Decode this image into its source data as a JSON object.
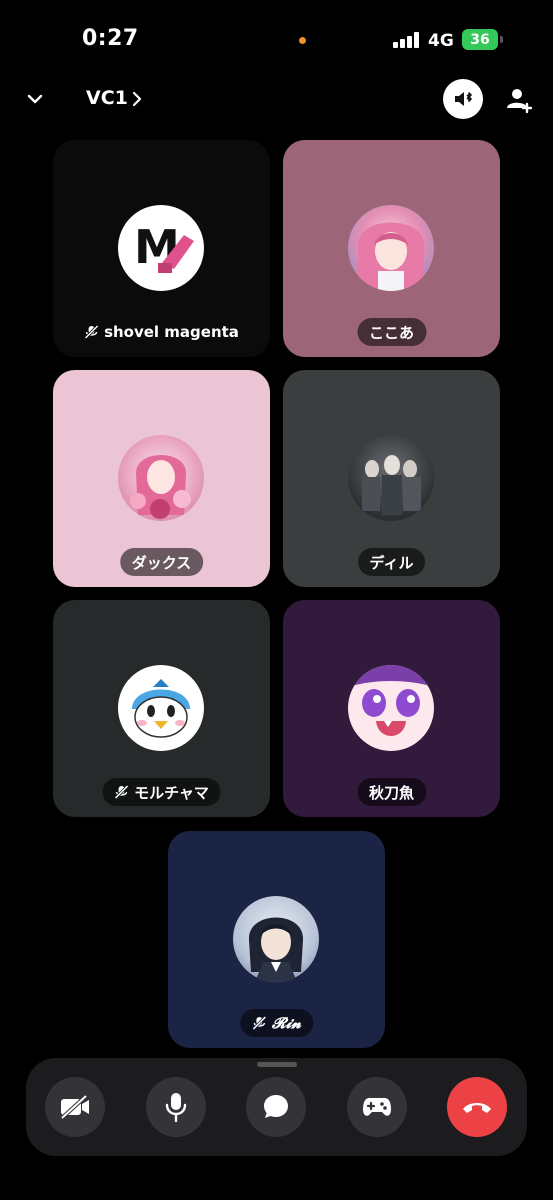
{
  "status_bar": {
    "time": "0:27",
    "network": "4G",
    "battery": "36"
  },
  "header": {
    "title": "VC1"
  },
  "participants": [
    {
      "name": "shovel magenta",
      "muted": true,
      "tile_color": "#0b0b0b",
      "avatar": "letter-m-shovel-icon"
    },
    {
      "name": "ここあ",
      "muted": false,
      "tile_color": "#9c6678",
      "avatar": "anime-girl-pink-hair"
    },
    {
      "name": "ダックス",
      "muted": false,
      "tile_color": "#ecc5d5",
      "avatar": "anime-girl-flowers"
    },
    {
      "name": "ディル",
      "muted": false,
      "tile_color": "#3a3e3e",
      "avatar": "anime-group-gray"
    },
    {
      "name": "モルチャマ",
      "muted": true,
      "tile_color": "#262a2a",
      "avatar": "piplup-icon"
    },
    {
      "name": "秋刀魚",
      "muted": false,
      "tile_color": "#321a3d",
      "avatar": "anime-face-purple-eyes"
    },
    {
      "name": "𝓡𝓲𝓷",
      "muted": true,
      "tile_color": "#1b2445",
      "avatar": "anime-girl-dark-hair"
    }
  ],
  "controls": [
    {
      "name": "camera-off",
      "icon": "camera-off-icon"
    },
    {
      "name": "microphone",
      "icon": "microphone-icon"
    },
    {
      "name": "chat",
      "icon": "chat-bubble-icon"
    },
    {
      "name": "activities",
      "icon": "gamepad-icon"
    },
    {
      "name": "leave-call",
      "icon": "phone-hangup-icon",
      "color": "#ed4245"
    }
  ]
}
